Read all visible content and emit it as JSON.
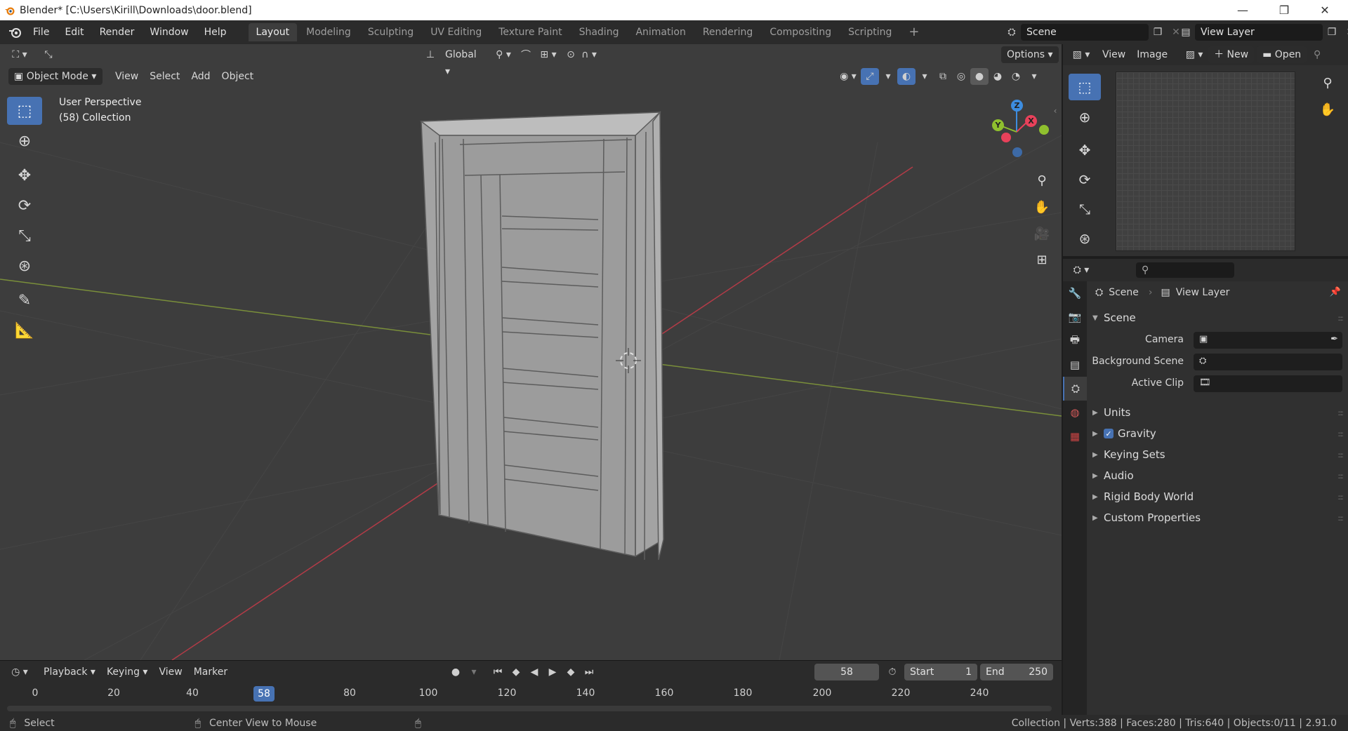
{
  "titlebar": {
    "title": "Blender* [C:\\Users\\Kirill\\Downloads\\door.blend]",
    "minimize": "—",
    "restore": "❐",
    "close": "✕"
  },
  "menu": {
    "items": [
      "File",
      "Edit",
      "Render",
      "Window",
      "Help"
    ]
  },
  "workspaces": {
    "tabs": [
      "Layout",
      "Modeling",
      "Sculpting",
      "UV Editing",
      "Texture Paint",
      "Shading",
      "Animation",
      "Rendering",
      "Compositing",
      "Scripting"
    ],
    "active": "Layout",
    "add": "+"
  },
  "scene_selector": {
    "value": "Scene"
  },
  "view_layer_selector": {
    "value": "View Layer"
  },
  "viewport": {
    "transform_orientation": "Global",
    "options_label": "Options",
    "mode": "Object Mode",
    "menus": [
      "View",
      "Select",
      "Add",
      "Object"
    ],
    "perspective_label": "User Perspective",
    "collection_label": "(58) Collection",
    "gizmo": {
      "z": "Z",
      "x": "X",
      "y": "Y"
    }
  },
  "image_editor": {
    "menus": [
      "View",
      "Image"
    ],
    "new_label": "New",
    "open_label": "Open"
  },
  "properties": {
    "breadcrumb_scene": "Scene",
    "breadcrumb_view_layer": "View Layer",
    "panel_title": "Scene",
    "fields": [
      {
        "label": "Camera"
      },
      {
        "label": "Background Scene"
      },
      {
        "label": "Active Clip"
      }
    ],
    "subpanels": [
      "Units",
      "Gravity",
      "Keying Sets",
      "Audio",
      "Rigid Body World",
      "Custom Properties"
    ],
    "gravity_checked": true
  },
  "timeline": {
    "menus": [
      "Playback",
      "Keying",
      "View",
      "Marker"
    ],
    "current_frame": "58",
    "start_label": "Start",
    "start_value": "1",
    "end_label": "End",
    "end_value": "250",
    "ticks": [
      "0",
      "20",
      "40",
      "80",
      "100",
      "120",
      "140",
      "160",
      "180",
      "200",
      "220",
      "240"
    ]
  },
  "statusbar": {
    "left_action": "Select",
    "middle_action": "Center View to Mouse",
    "stats": "Collection | Verts:388 | Faces:280 | Tris:640 | Objects:0/11 | 2.91.0"
  },
  "colors": {
    "accent": "#4772b3",
    "x_axis": "#e8415a",
    "y_axis": "#8fc02e",
    "z_axis": "#3d8de0"
  }
}
